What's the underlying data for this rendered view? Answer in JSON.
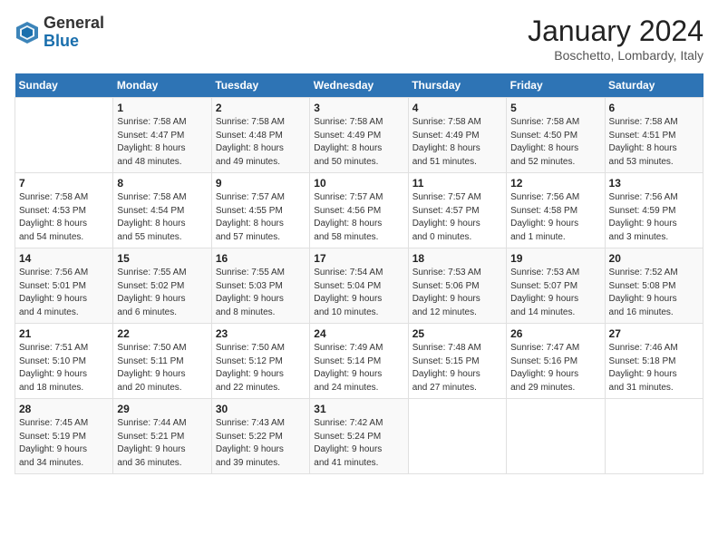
{
  "logo": {
    "general": "General",
    "blue": "Blue"
  },
  "title": "January 2024",
  "location": "Boschetto, Lombardy, Italy",
  "days_of_week": [
    "Sunday",
    "Monday",
    "Tuesday",
    "Wednesday",
    "Thursday",
    "Friday",
    "Saturday"
  ],
  "weeks": [
    [
      {
        "day": "",
        "info": ""
      },
      {
        "day": "1",
        "info": "Sunrise: 7:58 AM\nSunset: 4:47 PM\nDaylight: 8 hours\nand 48 minutes."
      },
      {
        "day": "2",
        "info": "Sunrise: 7:58 AM\nSunset: 4:48 PM\nDaylight: 8 hours\nand 49 minutes."
      },
      {
        "day": "3",
        "info": "Sunrise: 7:58 AM\nSunset: 4:49 PM\nDaylight: 8 hours\nand 50 minutes."
      },
      {
        "day": "4",
        "info": "Sunrise: 7:58 AM\nSunset: 4:49 PM\nDaylight: 8 hours\nand 51 minutes."
      },
      {
        "day": "5",
        "info": "Sunrise: 7:58 AM\nSunset: 4:50 PM\nDaylight: 8 hours\nand 52 minutes."
      },
      {
        "day": "6",
        "info": "Sunrise: 7:58 AM\nSunset: 4:51 PM\nDaylight: 8 hours\nand 53 minutes."
      }
    ],
    [
      {
        "day": "7",
        "info": "Sunrise: 7:58 AM\nSunset: 4:53 PM\nDaylight: 8 hours\nand 54 minutes."
      },
      {
        "day": "8",
        "info": "Sunrise: 7:58 AM\nSunset: 4:54 PM\nDaylight: 8 hours\nand 55 minutes."
      },
      {
        "day": "9",
        "info": "Sunrise: 7:57 AM\nSunset: 4:55 PM\nDaylight: 8 hours\nand 57 minutes."
      },
      {
        "day": "10",
        "info": "Sunrise: 7:57 AM\nSunset: 4:56 PM\nDaylight: 8 hours\nand 58 minutes."
      },
      {
        "day": "11",
        "info": "Sunrise: 7:57 AM\nSunset: 4:57 PM\nDaylight: 9 hours\nand 0 minutes."
      },
      {
        "day": "12",
        "info": "Sunrise: 7:56 AM\nSunset: 4:58 PM\nDaylight: 9 hours\nand 1 minute."
      },
      {
        "day": "13",
        "info": "Sunrise: 7:56 AM\nSunset: 4:59 PM\nDaylight: 9 hours\nand 3 minutes."
      }
    ],
    [
      {
        "day": "14",
        "info": "Sunrise: 7:56 AM\nSunset: 5:01 PM\nDaylight: 9 hours\nand 4 minutes."
      },
      {
        "day": "15",
        "info": "Sunrise: 7:55 AM\nSunset: 5:02 PM\nDaylight: 9 hours\nand 6 minutes."
      },
      {
        "day": "16",
        "info": "Sunrise: 7:55 AM\nSunset: 5:03 PM\nDaylight: 9 hours\nand 8 minutes."
      },
      {
        "day": "17",
        "info": "Sunrise: 7:54 AM\nSunset: 5:04 PM\nDaylight: 9 hours\nand 10 minutes."
      },
      {
        "day": "18",
        "info": "Sunrise: 7:53 AM\nSunset: 5:06 PM\nDaylight: 9 hours\nand 12 minutes."
      },
      {
        "day": "19",
        "info": "Sunrise: 7:53 AM\nSunset: 5:07 PM\nDaylight: 9 hours\nand 14 minutes."
      },
      {
        "day": "20",
        "info": "Sunrise: 7:52 AM\nSunset: 5:08 PM\nDaylight: 9 hours\nand 16 minutes."
      }
    ],
    [
      {
        "day": "21",
        "info": "Sunrise: 7:51 AM\nSunset: 5:10 PM\nDaylight: 9 hours\nand 18 minutes."
      },
      {
        "day": "22",
        "info": "Sunrise: 7:50 AM\nSunset: 5:11 PM\nDaylight: 9 hours\nand 20 minutes."
      },
      {
        "day": "23",
        "info": "Sunrise: 7:50 AM\nSunset: 5:12 PM\nDaylight: 9 hours\nand 22 minutes."
      },
      {
        "day": "24",
        "info": "Sunrise: 7:49 AM\nSunset: 5:14 PM\nDaylight: 9 hours\nand 24 minutes."
      },
      {
        "day": "25",
        "info": "Sunrise: 7:48 AM\nSunset: 5:15 PM\nDaylight: 9 hours\nand 27 minutes."
      },
      {
        "day": "26",
        "info": "Sunrise: 7:47 AM\nSunset: 5:16 PM\nDaylight: 9 hours\nand 29 minutes."
      },
      {
        "day": "27",
        "info": "Sunrise: 7:46 AM\nSunset: 5:18 PM\nDaylight: 9 hours\nand 31 minutes."
      }
    ],
    [
      {
        "day": "28",
        "info": "Sunrise: 7:45 AM\nSunset: 5:19 PM\nDaylight: 9 hours\nand 34 minutes."
      },
      {
        "day": "29",
        "info": "Sunrise: 7:44 AM\nSunset: 5:21 PM\nDaylight: 9 hours\nand 36 minutes."
      },
      {
        "day": "30",
        "info": "Sunrise: 7:43 AM\nSunset: 5:22 PM\nDaylight: 9 hours\nand 39 minutes."
      },
      {
        "day": "31",
        "info": "Sunrise: 7:42 AM\nSunset: 5:24 PM\nDaylight: 9 hours\nand 41 minutes."
      },
      {
        "day": "",
        "info": ""
      },
      {
        "day": "",
        "info": ""
      },
      {
        "day": "",
        "info": ""
      }
    ]
  ]
}
